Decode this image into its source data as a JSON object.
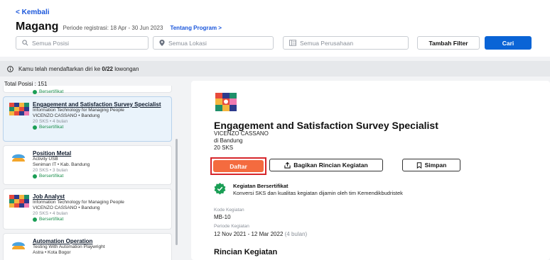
{
  "header": {
    "back_label": "< Kembali",
    "title": "Magang",
    "period": "Periode registrasi: 18 Apr - 30 Jun 2023",
    "program_link": "Tentang Program >"
  },
  "filters": {
    "position_placeholder": "Semua Posisi",
    "location_placeholder": "Semua Lokasi",
    "company_placeholder": "Semua Perusahaan",
    "add_filter_label": "Tambah Filter",
    "search_label": "Cari"
  },
  "notice": {
    "prefix": "Kamu telah mendaftarkan diri ke ",
    "count": "0/22",
    "suffix": " lowongan"
  },
  "total_label": "Total Posisi : 151",
  "list": {
    "top_badge": "Bersertifikat",
    "items": [
      {
        "title": "Engagement and Satisfaction Survey Specialist",
        "subtitle": "Information Technology for Managing People",
        "company": "VICENZO CASSANO • Bandung",
        "meta": "20 SKS • 4 bulan",
        "badge": "Bersertifikat"
      },
      {
        "title": "Position Metal",
        "subtitle": "Activity USB",
        "company": "Seniman IT • Kab. Bandung",
        "meta": "20 SKS • 3 bulan",
        "badge": "Bersertifikat"
      },
      {
        "title": "Job Analyst",
        "subtitle": "Information Technology for Managing People",
        "company": "VICENZO CASSANO • Bandung",
        "meta": "20 SKS • 4 bulan",
        "badge": "Bersertifikat"
      },
      {
        "title": "Automation Operation",
        "subtitle": "Testing With Automation Playwright",
        "company": "Astra • Kota Bogor",
        "meta": "",
        "badge": ""
      }
    ]
  },
  "detail": {
    "title": "Engagement and Satisfaction Survey Specialist",
    "company": "VICENZO CASSANO",
    "location": "di Bandung",
    "sks": "20 SKS",
    "apply_label": "Daftar",
    "share_label": "Bagikan Rincian Kegiatan",
    "save_label": "Simpan",
    "cert_title": "Kegiatan Bersertifikat",
    "cert_desc": "Konversi SKS dan kualitas kegiatan dijamin oleh tim Kemendikbudristek",
    "code_label": "Kode Kegiatan",
    "code_value": "MB-10",
    "period_label": "Periode Kegiatan",
    "period_value": "12 Nov 2021 - 12 Mar 2022",
    "period_duration": "(4 bulan)",
    "section_title": "Rincian Kegiatan"
  },
  "colors": {
    "accent": "#0a64d6",
    "apply": "#f46b3f",
    "highlight_border": "#d6262c",
    "certified": "#1a9e55"
  }
}
